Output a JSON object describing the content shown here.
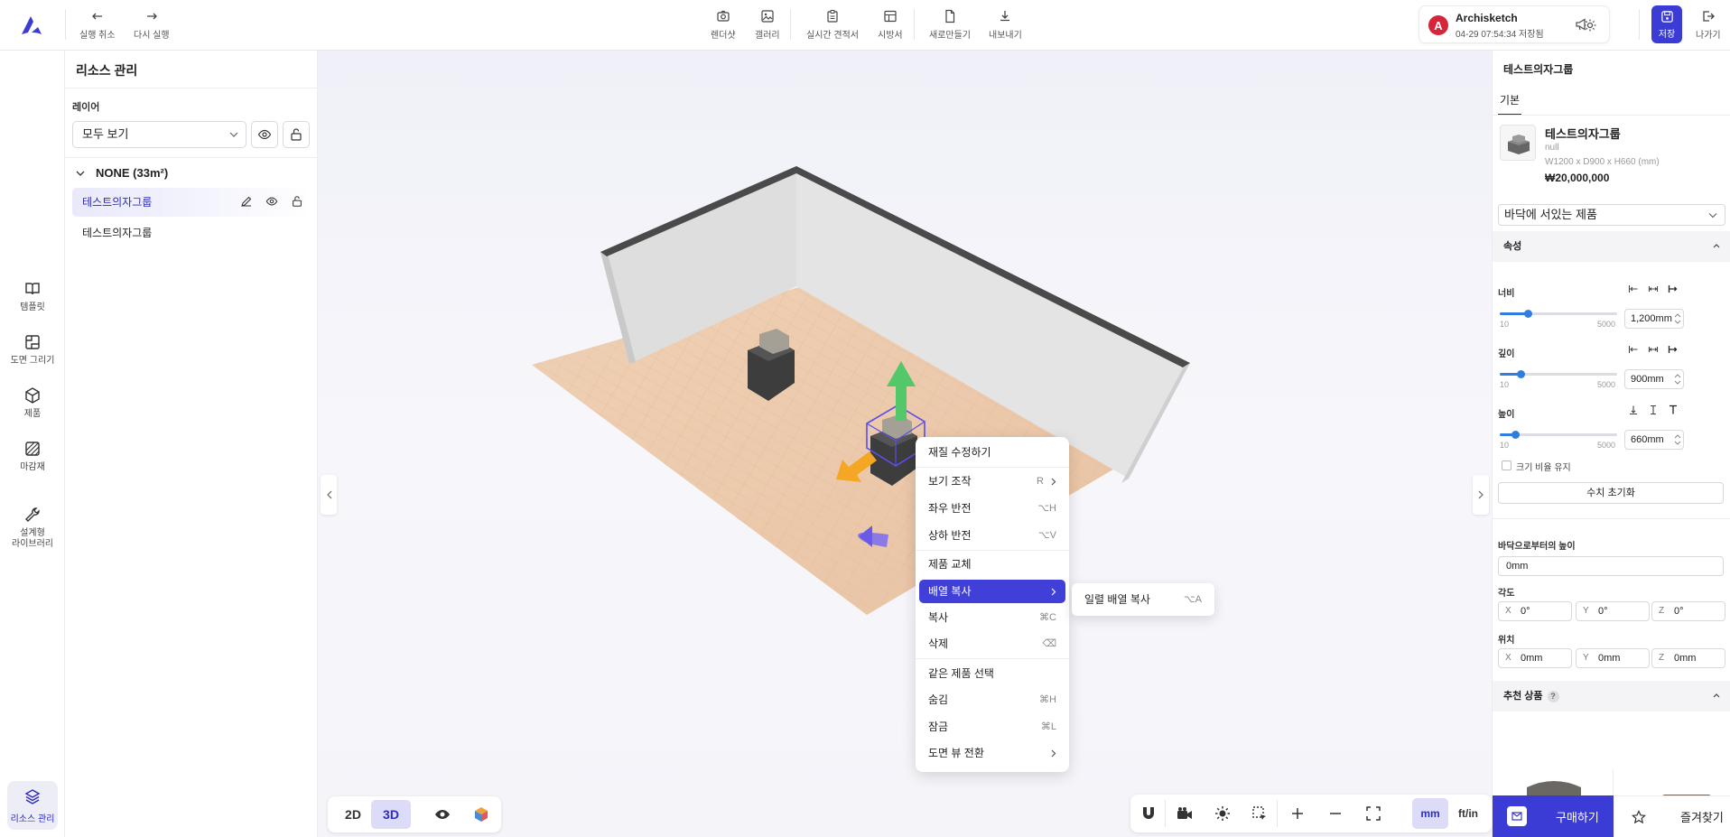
{
  "toolbar": {
    "undo": "실행 취소",
    "redo": "다시 실행",
    "render": "렌더샷",
    "gallery": "갤러리",
    "estimate": "실시간 견적서",
    "spec": "시방서",
    "new": "새로만들기",
    "export": "내보내기"
  },
  "user": {
    "initial": "A",
    "name": "Archisketch",
    "status": "04-29 07:54:34 저장됨"
  },
  "save_label": "저장",
  "exit_label": "나가기",
  "nav": {
    "template": "템플릿",
    "floorplan": "도면 그리기",
    "product": "제품",
    "finish": "마감재",
    "library_line1": "설계형",
    "library_line2": "라이브러리",
    "resource": "리소스 관리"
  },
  "resource_panel": {
    "title": "리소스 관리",
    "layer_label": "레이어",
    "layer_value": "모두 보기",
    "group_name": "NONE (33m²)",
    "items": [
      {
        "label": "테스트의자그룹"
      },
      {
        "label": "테스트의자그룹"
      }
    ]
  },
  "context_menu": {
    "items": [
      {
        "label": "재질 수정하기",
        "shortcut": ""
      },
      {
        "label": "보기 조작",
        "shortcut": "R"
      },
      {
        "label": "좌우 반전",
        "shortcut": "⌥H"
      },
      {
        "label": "상하 반전",
        "shortcut": "⌥V"
      },
      {
        "label": "제품 교체",
        "shortcut": ""
      },
      {
        "label": "배열 복사",
        "shortcut": ""
      },
      {
        "label": "복사",
        "shortcut": "⌘C"
      },
      {
        "label": "삭제",
        "shortcut": "⌫"
      },
      {
        "label": "같은 제품 선택",
        "shortcut": ""
      },
      {
        "label": "숨김",
        "shortcut": "⌘H"
      },
      {
        "label": "잠금",
        "shortcut": "⌘L"
      },
      {
        "label": "도면 뷰 전환",
        "shortcut": ""
      }
    ],
    "submenu": {
      "label": "일렬 배열 복사",
      "shortcut": "⌥A"
    }
  },
  "view_modes": {
    "mode_2d": "2D",
    "mode_3d": "3D",
    "active": "3D"
  },
  "units": {
    "mm": "mm",
    "ftin": "ft/in",
    "active": "mm"
  },
  "properties": {
    "title": "테스트의자그룹",
    "tab": "기본",
    "product_name": "테스트의자그룹",
    "brand": "null",
    "dimensions": "W1200 x D900 x H660 (mm)",
    "price": "₩20,000,000",
    "placement": "바닥에 서있는 제품",
    "section_attr": "속성",
    "width_label": "너비",
    "width_value": "1,200mm",
    "width_level": 0.24,
    "depth_label": "깊이",
    "depth_value": "900mm",
    "depth_level": 0.18,
    "height_label": "높이",
    "height_value": "660mm",
    "height_level": 0.13,
    "slider_min": "10",
    "slider_max": "5000",
    "keep_ratio": "크기 비율 유지",
    "reset": "수치 초기화",
    "floor_height_label": "바닥으로부터의 높이",
    "floor_height_value": "0mm",
    "angle_label": "각도",
    "angle": {
      "x": "0°",
      "y": "0°",
      "z": "0°"
    },
    "position_label": "위치",
    "position": {
      "x": "0mm",
      "y": "0mm",
      "z": "0mm"
    },
    "axis": {
      "x": "X",
      "y": "Y",
      "z": "Z"
    },
    "recommend": "추천 상품",
    "help": "?",
    "buy": "구매하기",
    "favorite": "즐겨찾기"
  },
  "colors": {
    "accent": "#3b3bd6",
    "selection_bg": "#ededf5",
    "slider": "#2f7de1"
  }
}
